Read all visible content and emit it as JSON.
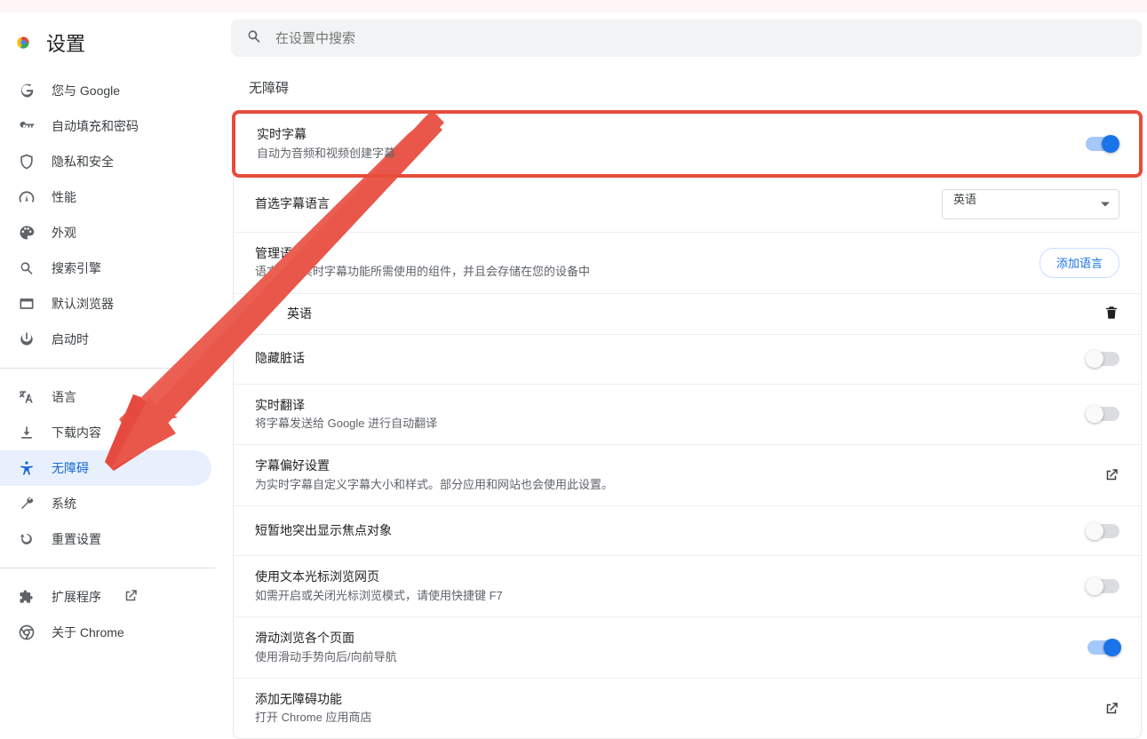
{
  "app": {
    "title": "设置"
  },
  "search": {
    "placeholder": "在设置中搜索"
  },
  "sidebar": {
    "items": [
      {
        "id": "you-google",
        "label": "您与 Google"
      },
      {
        "id": "autofill",
        "label": "自动填充和密码"
      },
      {
        "id": "privacy",
        "label": "隐私和安全"
      },
      {
        "id": "performance",
        "label": "性能"
      },
      {
        "id": "appearance",
        "label": "外观"
      },
      {
        "id": "search-engine",
        "label": "搜索引擎"
      },
      {
        "id": "default-browser",
        "label": "默认浏览器"
      },
      {
        "id": "on-startup",
        "label": "启动时"
      }
    ],
    "items2": [
      {
        "id": "languages",
        "label": "语言"
      },
      {
        "id": "downloads",
        "label": "下载内容"
      },
      {
        "id": "accessibility",
        "label": "无障碍",
        "selected": true
      },
      {
        "id": "system",
        "label": "系统"
      },
      {
        "id": "reset",
        "label": "重置设置"
      }
    ],
    "items3": [
      {
        "id": "extensions",
        "label": "扩展程序"
      },
      {
        "id": "about",
        "label": "关于 Chrome"
      }
    ]
  },
  "section": {
    "title": "无障碍"
  },
  "rows": {
    "live_caption": {
      "title": "实时字幕",
      "sub": "自动为音频和视频创建字幕",
      "on": true
    },
    "pref_lang": {
      "title": "首选字幕语言",
      "value": "英语"
    },
    "manage_lang": {
      "title": "管理语言",
      "sub": "语言包是实时字幕功能所需使用的组件，并且会存储在您的设备中",
      "button": "添加语言"
    },
    "lang_item": {
      "label": "英语"
    },
    "hide_profanity": {
      "title": "隐藏脏话",
      "on": false
    },
    "live_translate": {
      "title": "实时翻译",
      "sub": "将字幕发送给 Google 进行自动翻译",
      "on": false
    },
    "caption_prefs": {
      "title": "字幕偏好设置",
      "sub": "为实时字幕自定义字幕大小和样式。部分应用和网站也会使用此设置。"
    },
    "focus_highlight": {
      "title": "短暂地突出显示焦点对象",
      "on": false
    },
    "caret_browsing": {
      "title": "使用文本光标浏览网页",
      "sub": "如需开启或关闭光标浏览模式，请使用快捷键 F7",
      "on": false
    },
    "swipe_nav": {
      "title": "滑动浏览各个页面",
      "sub": "使用滑动手势向后/向前导航",
      "on": true
    },
    "add_a11y": {
      "title": "添加无障碍功能",
      "sub": "打开 Chrome 应用商店"
    }
  }
}
